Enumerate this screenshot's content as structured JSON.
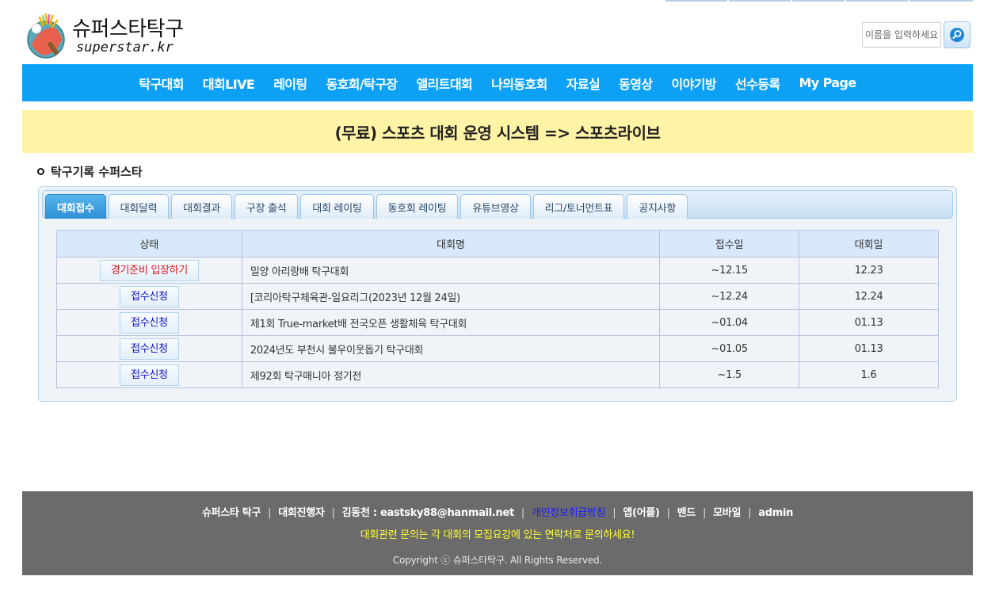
{
  "header": {
    "logo_title": "슈퍼스타탁구",
    "logo_subtitle": "superstar.kr"
  },
  "search": {
    "placeholder": "이름을 입력하세요"
  },
  "nav": {
    "items": [
      "탁구대회",
      "대회LIVE",
      "레이팅",
      "동호회/탁구장",
      "앨리트대회",
      "나의동호회",
      "자료실",
      "동영상",
      "이야기방",
      "선수등록",
      "My Page"
    ]
  },
  "banner": {
    "text": "(무료) 스포츠 대회 운영 시스템 => 스포츠라이브"
  },
  "section": {
    "title": "탁구기록 수퍼스타"
  },
  "tabs": [
    "대회접수",
    "대회달력",
    "대회결과",
    "구장 출석",
    "대회 레이팅",
    "동호회 레이팅",
    "유튜브영상",
    "리그/토너먼트표",
    "공지사항"
  ],
  "table": {
    "headers": [
      "상태",
      "대회명",
      "접수일",
      "대회일"
    ],
    "rows": [
      {
        "status": "경기준비 입장하기",
        "name": "밀양 아리랑배 탁구대회",
        "receipt": "~12.15",
        "date": "12.23"
      },
      {
        "status": "접수신청",
        "name": "[코리아탁구체육관-일요리그(2023년 12월 24일)",
        "receipt": "~12.24",
        "date": "12.24"
      },
      {
        "status": "접수신청",
        "name": "제1회 True-market배 전국오픈 생활체육 탁구대회",
        "receipt": "~01.04",
        "date": "01.13"
      },
      {
        "status": "접수신청",
        "name": "2024년도 부천시 불우이웃돕기 탁구대회",
        "receipt": "~01.05",
        "date": "01.13"
      },
      {
        "status": "접수신청",
        "name": "제92회 탁구매니아 정기전",
        "receipt": "~1.5",
        "date": "1.6"
      }
    ]
  },
  "footer": {
    "links": [
      "슈퍼스타 탁구",
      "대회진행자",
      "김동천 : eastsky88@hanmail.net",
      "개인정보취급방침",
      "앱(어플)",
      "밴드",
      "모바일",
      "admin"
    ],
    "notice": "대회관련 문의는 각 대회의 모집요강에 있는 연락처로 문의하세요!",
    "copyright": "Copyright ⓒ 슈퍼스타탁구. All Rights Reserved."
  },
  "colors": {
    "nav_bg": "#0da1f5",
    "banner_bg": "#fff3a6",
    "footer_bg": "#6b6b6b",
    "active_tab": "#2d8fd6",
    "status_red": "#e0151f",
    "status_blue": "#1010c8",
    "notice_yellow": "#ffff33"
  }
}
